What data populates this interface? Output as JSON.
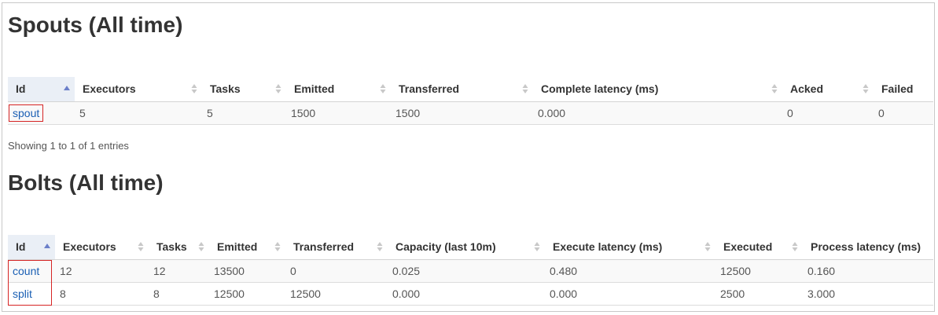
{
  "spouts": {
    "title": "Spouts (All time)",
    "columns": [
      "Id",
      "Executors",
      "Tasks",
      "Emitted",
      "Transferred",
      "Complete latency (ms)",
      "Acked",
      "Failed"
    ],
    "rows": [
      [
        "spout",
        "5",
        "5",
        "1500",
        "1500",
        "0.000",
        "0",
        "0"
      ]
    ],
    "info": "Showing 1 to 1 of 1 entries"
  },
  "bolts": {
    "title": "Bolts (All time)",
    "columns": [
      "Id",
      "Executors",
      "Tasks",
      "Emitted",
      "Transferred",
      "Capacity (last 10m)",
      "Execute latency (ms)",
      "Executed",
      "Process latency (ms)"
    ],
    "rows": [
      [
        "count",
        "12",
        "12",
        "13500",
        "0",
        "0.025",
        "0.480",
        "12500",
        "0.160"
      ],
      [
        "split",
        "8",
        "8",
        "12500",
        "12500",
        "0.000",
        "0.000",
        "2500",
        "3.000"
      ]
    ]
  },
  "colors": {
    "sort_active": "#6b7fc9",
    "sort_inactive": "#c8c8c8",
    "link": "#1a5fb4",
    "highlight_box": "#d62424"
  },
  "icons": {
    "sort_active": "sort-asc-icon",
    "sort_inactive": "sort-both-icon"
  }
}
